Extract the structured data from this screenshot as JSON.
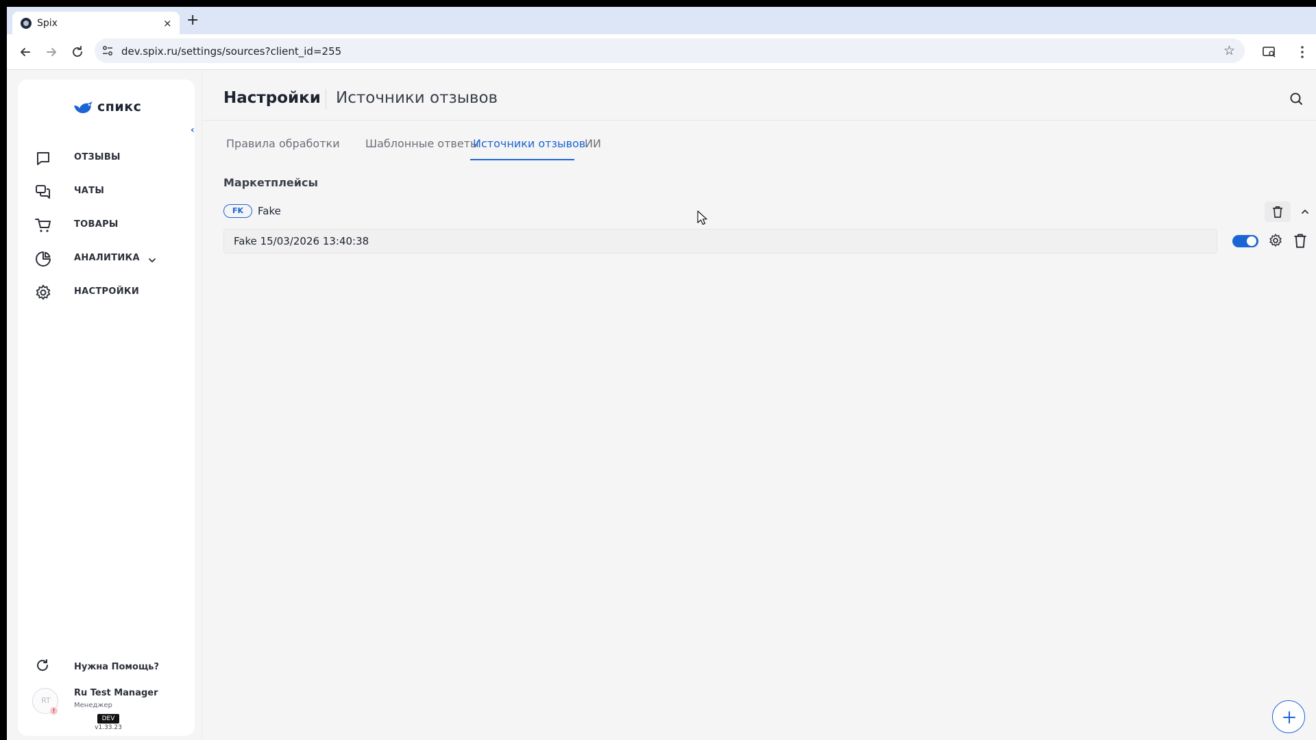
{
  "browser": {
    "tab_title": "Spix",
    "tab_close": "×",
    "new_tab": "+",
    "url": "dev.spix.ru/settings/sources?client_id=255",
    "star": "☆"
  },
  "sidebar": {
    "logo_text": "спикс",
    "collapse_glyph": "‹",
    "items": [
      {
        "label": "ОТЗЫВЫ",
        "icon": "square-icon"
      },
      {
        "label": "ЧАТЫ",
        "icon": "chat-icon"
      },
      {
        "label": "ТОВАРЫ",
        "icon": "cart-icon"
      },
      {
        "label": "АНАЛИТИКА",
        "icon": "pie-chart-icon"
      },
      {
        "label": "НАСТРОЙКИ",
        "icon": "gear-icon"
      }
    ],
    "help_label": "Нужна Помощь?",
    "user": {
      "initials": "RT",
      "name": "Ru Test Manager",
      "role": "Менеджер",
      "alert": "!"
    },
    "env_badge": "DEV",
    "version": "v1.33.23"
  },
  "header": {
    "title": "Настройки",
    "subtitle": "Источники отзывов"
  },
  "tabs": [
    {
      "label": "Правила обработки",
      "active": false
    },
    {
      "label": "Шаблонные ответы",
      "active": false
    },
    {
      "label": "Источники отзывов",
      "active": true
    },
    {
      "label": "ИИ",
      "active": false
    }
  ],
  "section": {
    "title": "Маркетплейсы",
    "source": {
      "badge": "FK",
      "name": "Fake",
      "rows": [
        {
          "text": "Fake 15/03/2026 13:40:38",
          "enabled": true
        }
      ]
    }
  },
  "colors": {
    "accent": "#1b64d4",
    "text": "#1d2330",
    "muted": "#6a6f78"
  }
}
